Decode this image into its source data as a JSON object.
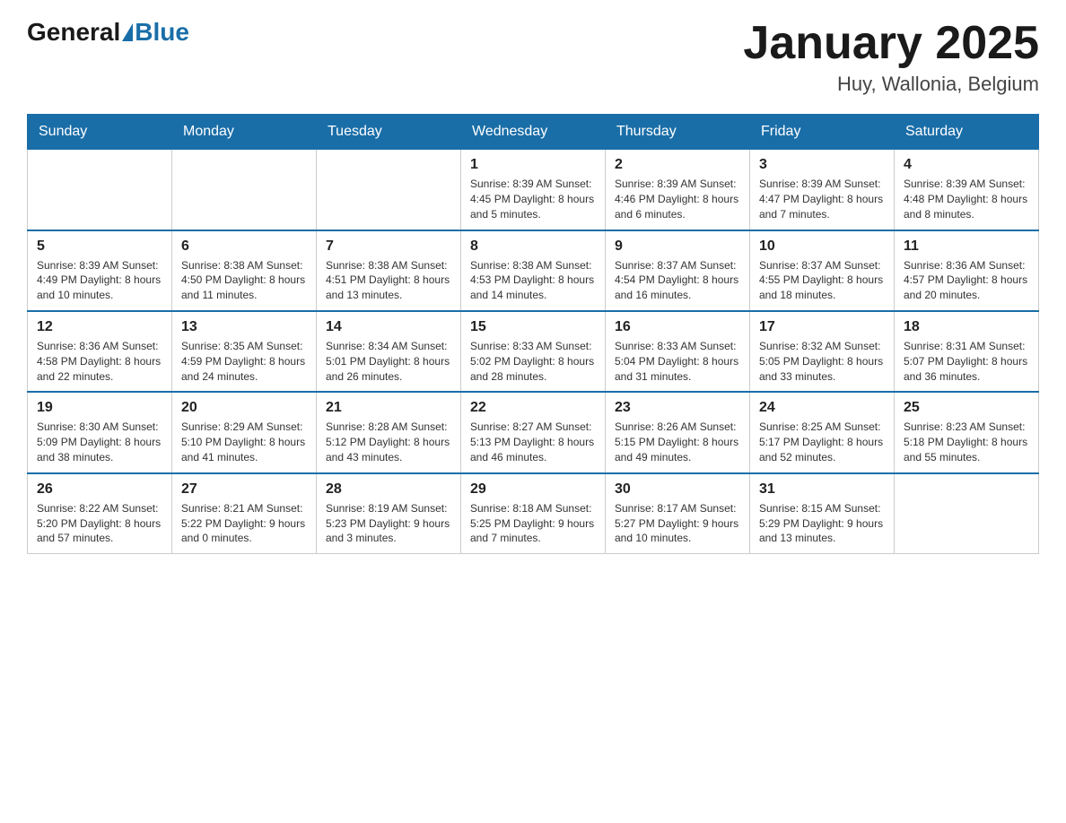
{
  "header": {
    "logo_general": "General",
    "logo_blue": "Blue",
    "month_title": "January 2025",
    "location": "Huy, Wallonia, Belgium"
  },
  "days_of_week": [
    "Sunday",
    "Monday",
    "Tuesday",
    "Wednesday",
    "Thursday",
    "Friday",
    "Saturday"
  ],
  "weeks": [
    [
      {
        "day": "",
        "info": ""
      },
      {
        "day": "",
        "info": ""
      },
      {
        "day": "",
        "info": ""
      },
      {
        "day": "1",
        "info": "Sunrise: 8:39 AM\nSunset: 4:45 PM\nDaylight: 8 hours\nand 5 minutes."
      },
      {
        "day": "2",
        "info": "Sunrise: 8:39 AM\nSunset: 4:46 PM\nDaylight: 8 hours\nand 6 minutes."
      },
      {
        "day": "3",
        "info": "Sunrise: 8:39 AM\nSunset: 4:47 PM\nDaylight: 8 hours\nand 7 minutes."
      },
      {
        "day": "4",
        "info": "Sunrise: 8:39 AM\nSunset: 4:48 PM\nDaylight: 8 hours\nand 8 minutes."
      }
    ],
    [
      {
        "day": "5",
        "info": "Sunrise: 8:39 AM\nSunset: 4:49 PM\nDaylight: 8 hours\nand 10 minutes."
      },
      {
        "day": "6",
        "info": "Sunrise: 8:38 AM\nSunset: 4:50 PM\nDaylight: 8 hours\nand 11 minutes."
      },
      {
        "day": "7",
        "info": "Sunrise: 8:38 AM\nSunset: 4:51 PM\nDaylight: 8 hours\nand 13 minutes."
      },
      {
        "day": "8",
        "info": "Sunrise: 8:38 AM\nSunset: 4:53 PM\nDaylight: 8 hours\nand 14 minutes."
      },
      {
        "day": "9",
        "info": "Sunrise: 8:37 AM\nSunset: 4:54 PM\nDaylight: 8 hours\nand 16 minutes."
      },
      {
        "day": "10",
        "info": "Sunrise: 8:37 AM\nSunset: 4:55 PM\nDaylight: 8 hours\nand 18 minutes."
      },
      {
        "day": "11",
        "info": "Sunrise: 8:36 AM\nSunset: 4:57 PM\nDaylight: 8 hours\nand 20 minutes."
      }
    ],
    [
      {
        "day": "12",
        "info": "Sunrise: 8:36 AM\nSunset: 4:58 PM\nDaylight: 8 hours\nand 22 minutes."
      },
      {
        "day": "13",
        "info": "Sunrise: 8:35 AM\nSunset: 4:59 PM\nDaylight: 8 hours\nand 24 minutes."
      },
      {
        "day": "14",
        "info": "Sunrise: 8:34 AM\nSunset: 5:01 PM\nDaylight: 8 hours\nand 26 minutes."
      },
      {
        "day": "15",
        "info": "Sunrise: 8:33 AM\nSunset: 5:02 PM\nDaylight: 8 hours\nand 28 minutes."
      },
      {
        "day": "16",
        "info": "Sunrise: 8:33 AM\nSunset: 5:04 PM\nDaylight: 8 hours\nand 31 minutes."
      },
      {
        "day": "17",
        "info": "Sunrise: 8:32 AM\nSunset: 5:05 PM\nDaylight: 8 hours\nand 33 minutes."
      },
      {
        "day": "18",
        "info": "Sunrise: 8:31 AM\nSunset: 5:07 PM\nDaylight: 8 hours\nand 36 minutes."
      }
    ],
    [
      {
        "day": "19",
        "info": "Sunrise: 8:30 AM\nSunset: 5:09 PM\nDaylight: 8 hours\nand 38 minutes."
      },
      {
        "day": "20",
        "info": "Sunrise: 8:29 AM\nSunset: 5:10 PM\nDaylight: 8 hours\nand 41 minutes."
      },
      {
        "day": "21",
        "info": "Sunrise: 8:28 AM\nSunset: 5:12 PM\nDaylight: 8 hours\nand 43 minutes."
      },
      {
        "day": "22",
        "info": "Sunrise: 8:27 AM\nSunset: 5:13 PM\nDaylight: 8 hours\nand 46 minutes."
      },
      {
        "day": "23",
        "info": "Sunrise: 8:26 AM\nSunset: 5:15 PM\nDaylight: 8 hours\nand 49 minutes."
      },
      {
        "day": "24",
        "info": "Sunrise: 8:25 AM\nSunset: 5:17 PM\nDaylight: 8 hours\nand 52 minutes."
      },
      {
        "day": "25",
        "info": "Sunrise: 8:23 AM\nSunset: 5:18 PM\nDaylight: 8 hours\nand 55 minutes."
      }
    ],
    [
      {
        "day": "26",
        "info": "Sunrise: 8:22 AM\nSunset: 5:20 PM\nDaylight: 8 hours\nand 57 minutes."
      },
      {
        "day": "27",
        "info": "Sunrise: 8:21 AM\nSunset: 5:22 PM\nDaylight: 9 hours\nand 0 minutes."
      },
      {
        "day": "28",
        "info": "Sunrise: 8:19 AM\nSunset: 5:23 PM\nDaylight: 9 hours\nand 3 minutes."
      },
      {
        "day": "29",
        "info": "Sunrise: 8:18 AM\nSunset: 5:25 PM\nDaylight: 9 hours\nand 7 minutes."
      },
      {
        "day": "30",
        "info": "Sunrise: 8:17 AM\nSunset: 5:27 PM\nDaylight: 9 hours\nand 10 minutes."
      },
      {
        "day": "31",
        "info": "Sunrise: 8:15 AM\nSunset: 5:29 PM\nDaylight: 9 hours\nand 13 minutes."
      },
      {
        "day": "",
        "info": ""
      }
    ]
  ]
}
